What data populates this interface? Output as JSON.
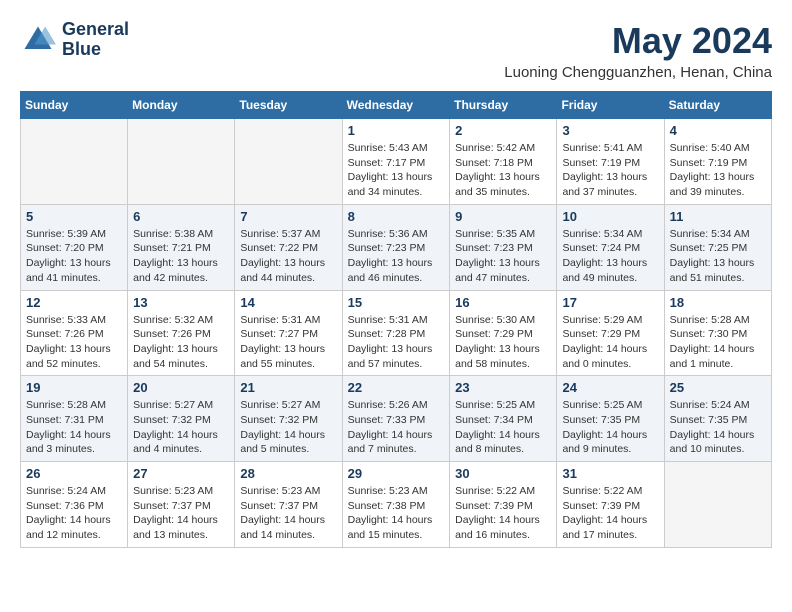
{
  "logo": {
    "line1": "General",
    "line2": "Blue"
  },
  "title": "May 2024",
  "location": "Luoning Chengguanzhen, Henan, China",
  "weekdays": [
    "Sunday",
    "Monday",
    "Tuesday",
    "Wednesday",
    "Thursday",
    "Friday",
    "Saturday"
  ],
  "weeks": [
    [
      {
        "day": "",
        "info": ""
      },
      {
        "day": "",
        "info": ""
      },
      {
        "day": "",
        "info": ""
      },
      {
        "day": "1",
        "info": "Sunrise: 5:43 AM\nSunset: 7:17 PM\nDaylight: 13 hours\nand 34 minutes."
      },
      {
        "day": "2",
        "info": "Sunrise: 5:42 AM\nSunset: 7:18 PM\nDaylight: 13 hours\nand 35 minutes."
      },
      {
        "day": "3",
        "info": "Sunrise: 5:41 AM\nSunset: 7:19 PM\nDaylight: 13 hours\nand 37 minutes."
      },
      {
        "day": "4",
        "info": "Sunrise: 5:40 AM\nSunset: 7:19 PM\nDaylight: 13 hours\nand 39 minutes."
      }
    ],
    [
      {
        "day": "5",
        "info": "Sunrise: 5:39 AM\nSunset: 7:20 PM\nDaylight: 13 hours\nand 41 minutes."
      },
      {
        "day": "6",
        "info": "Sunrise: 5:38 AM\nSunset: 7:21 PM\nDaylight: 13 hours\nand 42 minutes."
      },
      {
        "day": "7",
        "info": "Sunrise: 5:37 AM\nSunset: 7:22 PM\nDaylight: 13 hours\nand 44 minutes."
      },
      {
        "day": "8",
        "info": "Sunrise: 5:36 AM\nSunset: 7:23 PM\nDaylight: 13 hours\nand 46 minutes."
      },
      {
        "day": "9",
        "info": "Sunrise: 5:35 AM\nSunset: 7:23 PM\nDaylight: 13 hours\nand 47 minutes."
      },
      {
        "day": "10",
        "info": "Sunrise: 5:34 AM\nSunset: 7:24 PM\nDaylight: 13 hours\nand 49 minutes."
      },
      {
        "day": "11",
        "info": "Sunrise: 5:34 AM\nSunset: 7:25 PM\nDaylight: 13 hours\nand 51 minutes."
      }
    ],
    [
      {
        "day": "12",
        "info": "Sunrise: 5:33 AM\nSunset: 7:26 PM\nDaylight: 13 hours\nand 52 minutes."
      },
      {
        "day": "13",
        "info": "Sunrise: 5:32 AM\nSunset: 7:26 PM\nDaylight: 13 hours\nand 54 minutes."
      },
      {
        "day": "14",
        "info": "Sunrise: 5:31 AM\nSunset: 7:27 PM\nDaylight: 13 hours\nand 55 minutes."
      },
      {
        "day": "15",
        "info": "Sunrise: 5:31 AM\nSunset: 7:28 PM\nDaylight: 13 hours\nand 57 minutes."
      },
      {
        "day": "16",
        "info": "Sunrise: 5:30 AM\nSunset: 7:29 PM\nDaylight: 13 hours\nand 58 minutes."
      },
      {
        "day": "17",
        "info": "Sunrise: 5:29 AM\nSunset: 7:29 PM\nDaylight: 14 hours\nand 0 minutes."
      },
      {
        "day": "18",
        "info": "Sunrise: 5:28 AM\nSunset: 7:30 PM\nDaylight: 14 hours\nand 1 minute."
      }
    ],
    [
      {
        "day": "19",
        "info": "Sunrise: 5:28 AM\nSunset: 7:31 PM\nDaylight: 14 hours\nand 3 minutes."
      },
      {
        "day": "20",
        "info": "Sunrise: 5:27 AM\nSunset: 7:32 PM\nDaylight: 14 hours\nand 4 minutes."
      },
      {
        "day": "21",
        "info": "Sunrise: 5:27 AM\nSunset: 7:32 PM\nDaylight: 14 hours\nand 5 minutes."
      },
      {
        "day": "22",
        "info": "Sunrise: 5:26 AM\nSunset: 7:33 PM\nDaylight: 14 hours\nand 7 minutes."
      },
      {
        "day": "23",
        "info": "Sunrise: 5:25 AM\nSunset: 7:34 PM\nDaylight: 14 hours\nand 8 minutes."
      },
      {
        "day": "24",
        "info": "Sunrise: 5:25 AM\nSunset: 7:35 PM\nDaylight: 14 hours\nand 9 minutes."
      },
      {
        "day": "25",
        "info": "Sunrise: 5:24 AM\nSunset: 7:35 PM\nDaylight: 14 hours\nand 10 minutes."
      }
    ],
    [
      {
        "day": "26",
        "info": "Sunrise: 5:24 AM\nSunset: 7:36 PM\nDaylight: 14 hours\nand 12 minutes."
      },
      {
        "day": "27",
        "info": "Sunrise: 5:23 AM\nSunset: 7:37 PM\nDaylight: 14 hours\nand 13 minutes."
      },
      {
        "day": "28",
        "info": "Sunrise: 5:23 AM\nSunset: 7:37 PM\nDaylight: 14 hours\nand 14 minutes."
      },
      {
        "day": "29",
        "info": "Sunrise: 5:23 AM\nSunset: 7:38 PM\nDaylight: 14 hours\nand 15 minutes."
      },
      {
        "day": "30",
        "info": "Sunrise: 5:22 AM\nSunset: 7:39 PM\nDaylight: 14 hours\nand 16 minutes."
      },
      {
        "day": "31",
        "info": "Sunrise: 5:22 AM\nSunset: 7:39 PM\nDaylight: 14 hours\nand 17 minutes."
      },
      {
        "day": "",
        "info": ""
      }
    ]
  ]
}
